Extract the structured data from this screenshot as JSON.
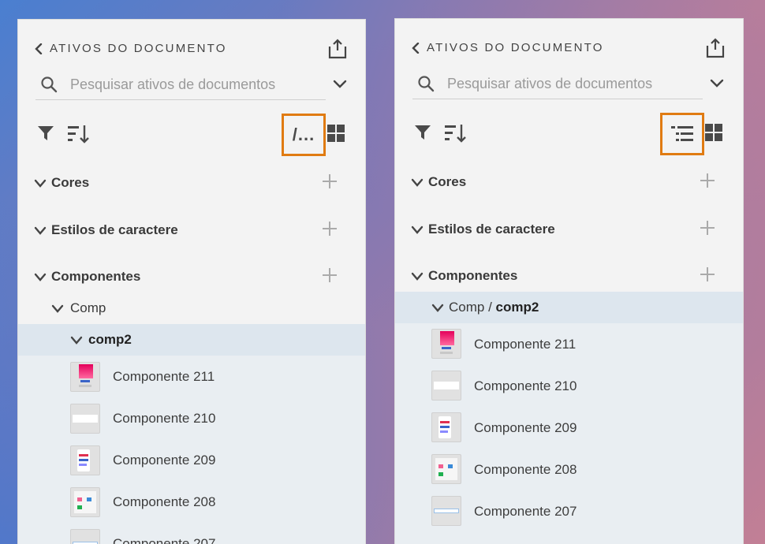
{
  "left": {
    "title": "ATIVOS DO DOCUMENTO",
    "search_placeholder": "Pesquisar ativos de documentos",
    "path_toggle_glyph": "/...",
    "sections": [
      "Cores",
      "Estilos de caractere",
      "Componentes"
    ],
    "folder_parent": "Comp",
    "folder_child": "comp2",
    "items": [
      "Componente 211",
      "Componente 210",
      "Componente 209",
      "Componente 208",
      "Componente 207"
    ]
  },
  "right": {
    "title": "ATIVOS DO DOCUMENTO",
    "search_placeholder": "Pesquisar ativos de documentos",
    "sections": [
      "Cores",
      "Estilos de caractere",
      "Componentes"
    ],
    "folder_parent": "Comp",
    "folder_separator": " / ",
    "folder_child": "comp2",
    "items": [
      "Componente 211",
      "Componente 210",
      "Componente 209",
      "Componente 208",
      "Componente 207"
    ]
  },
  "colors": {
    "highlight": "#e07b12",
    "selected_row": "#dde6ee",
    "list_bg": "#e9eef2"
  },
  "icons": [
    "chevron-left-icon",
    "share-icon",
    "search-icon",
    "chevron-down-icon",
    "filter-icon",
    "sort-icon",
    "grid-view-icon",
    "tree-view-icon",
    "plus-icon"
  ]
}
